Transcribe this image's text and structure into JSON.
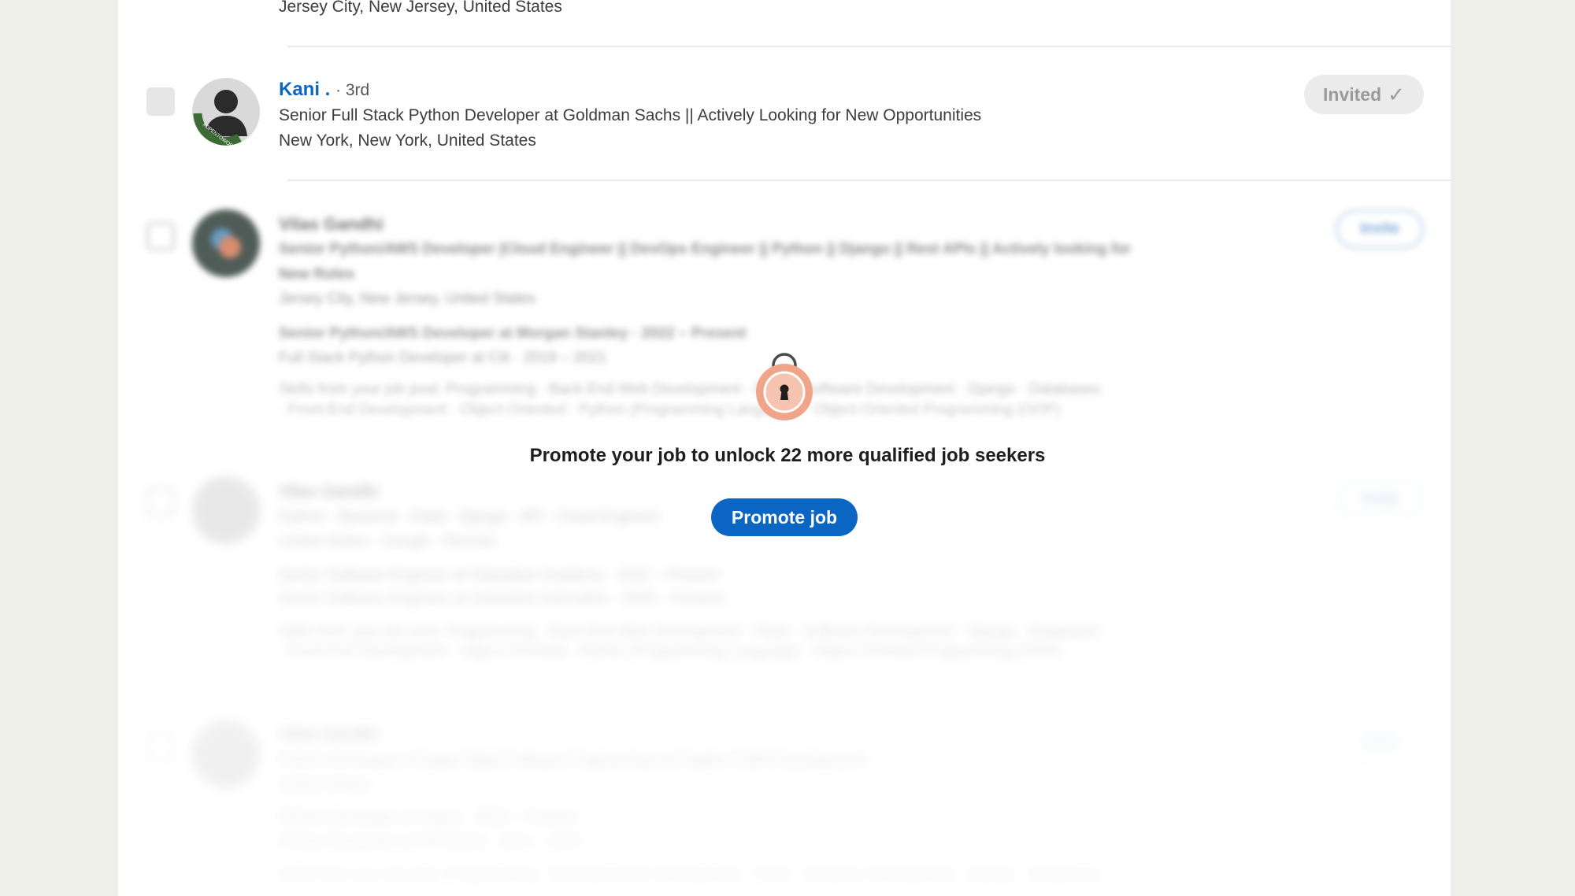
{
  "top_row": {
    "location": "Jersey City, New Jersey, United States"
  },
  "candidate_kani": {
    "name": "Kani .",
    "degree": "· 3rd",
    "headline": "Senior Full Stack Python Developer at Goldman Sachs || Actively Looking for New Opportunities",
    "location": "New York, New York, United States",
    "invite_label": "Invited",
    "avatar_frame_text": "#OPENTOWORK"
  },
  "blurred_1": {
    "name": "Vilas Gandhi",
    "headline": "Senior Python/AWS Developer |Cloud Engineer || DevOps Engineer || Python || Django || Rest APIs || Actively looking for",
    "headline_cont": "New Roles",
    "location": "Jersey City, New Jersey, United States",
    "exp1": "Senior Python/AWS Developer at Morgan Stanley · 2022 – Present",
    "exp2": "Full Stack Python Developer at Citi · 2019 – 2021",
    "skills1": "Skills from your job post: Programming · Back-End Web Development · Flask · Software Development · Django · Databases",
    "skills2": "· Front-End Development · Object-Oriented · Python (Programming Language) · Object-Oriented Programming (OOP)",
    "invite_label": "Invite"
  },
  "blurred_2": {
    "name": "Vilas Gandhi",
    "headline": "Python · Backend · Flask · Django · API · Cloud Engineer",
    "location": "United States · Google · Remote",
    "exp1": "Senior Software Engineer at Glassdoor Academy · 2021 – Present",
    "exp2": "Senior Software Engineer at Glassdoor Education · 2020 – Present",
    "skills1": "Skills from your job post: Programming · Back-End Web Development · Flask · Software Development · Django · Databases",
    "skills2": "· Front-End Development · Object-Oriented · Python (Programming Language) · Object-Oriented Programming (OOP)",
    "invite_label": "Invite"
  },
  "blurred_3": {
    "name": "Vilas Gandhi",
    "headline": "Python Developer at Sagar Digital Software Engineering and Apple & AWS Development",
    "location": "United States",
    "exp1": "Python Developer at Capco · 2023 – Present",
    "exp2": "Python Developer at Pill Global · 2021 – 2022",
    "skills1": "Skills from your job post: Programming · Back-End Web Development · Flask · Software Development · Django · Databases",
    "skills2": "· Front-End Development · Object-Oriented · Python (Programming Language) · Object-Oriented Programming (OOP)",
    "invite_label": "Invite"
  },
  "promo": {
    "message": "Promote your job to unlock 22 more qualified job seekers",
    "button_label": "Promote job"
  },
  "colors": {
    "link_blue": "#0a66c2",
    "lock_body": "#f0a489",
    "button_blue": "#0a66c2"
  },
  "icons": {
    "invited_check": "check-icon",
    "lock": "lock-icon"
  }
}
